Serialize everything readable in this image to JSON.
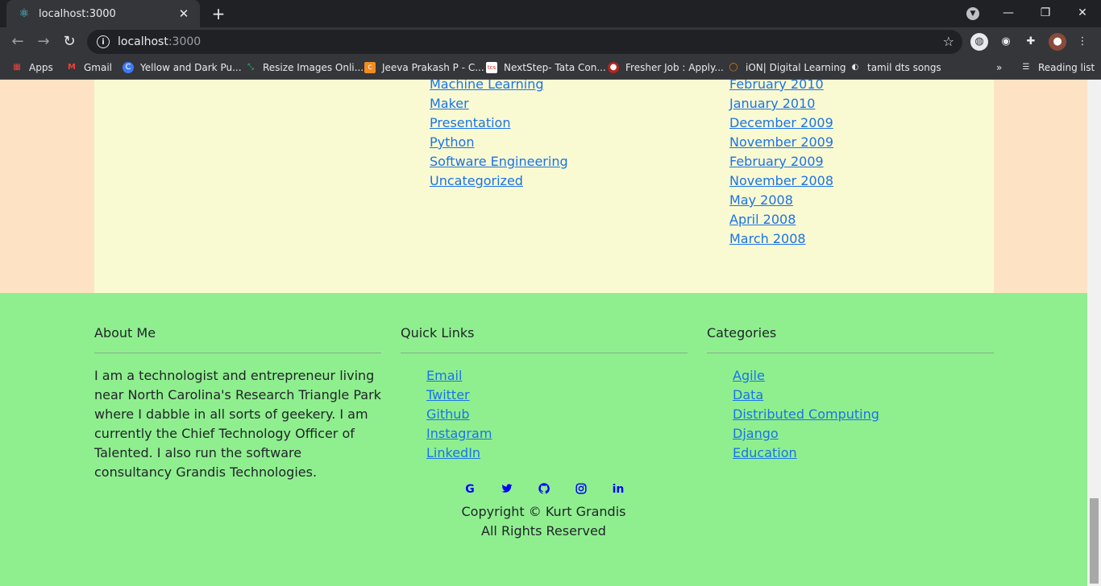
{
  "browser": {
    "tab_title": "localhost:3000",
    "url_host": "localhost",
    "url_port": ":3000",
    "bookmarks": [
      {
        "label": "Apps",
        "icon": "apps-icon",
        "color": "#e8453c"
      },
      {
        "label": "Gmail",
        "icon": "gmail-icon",
        "color": "#ea4335"
      },
      {
        "label": "Yellow and Dark Pu...",
        "icon": "canva-icon",
        "color": "#3d7af5"
      },
      {
        "label": "Resize Images Onli...",
        "icon": "resize-icon",
        "color": "#2bbf6a"
      },
      {
        "label": "Jeeva Prakash P - C...",
        "icon": "resume-icon",
        "color": "#f28b20"
      },
      {
        "label": "NextStep- Tata Con...",
        "icon": "tcs-icon",
        "color": "#d93025"
      },
      {
        "label": "Fresher Job : Apply...",
        "icon": "fresher-icon",
        "color": "#b3261e"
      },
      {
        "label": "iON| Digital Learning",
        "icon": "ion-icon",
        "color": "#f57c00"
      },
      {
        "label": "tamil dts songs",
        "icon": "globe-icon",
        "color": "#e8eaed"
      }
    ],
    "reading_list": "Reading list",
    "more_bookmarks": "»"
  },
  "blog": {
    "categories": [
      "Machine Learning",
      "Maker",
      "Presentation",
      "Python",
      "Software Engineering",
      "Uncategorized"
    ],
    "archives": [
      "February 2010",
      "January 2010",
      "December 2009",
      "November 2009",
      "February 2009",
      "November 2008",
      "May 2008",
      "April 2008",
      "March 2008"
    ]
  },
  "footer": {
    "about_title": "About Me",
    "about_text": "I am a technologist and entrepreneur living near North Carolina's Research Triangle Park where I dabble in all sorts of geekery. I am currently the Chief Technology Officer of Talented. I also run the software consultancy Grandis Technologies.",
    "quick_title": "Quick Links",
    "quick_links": [
      "Email",
      "Twitter",
      "Github",
      "Instagram",
      "LinkedIn"
    ],
    "cat_title": "Categories",
    "categories": [
      "Agile",
      "Data",
      "Distributed Computing",
      "Django",
      "Education"
    ],
    "social_icons": [
      "google-icon",
      "twitter-icon",
      "github-icon",
      "instagram-icon",
      "linkedin-icon"
    ],
    "copyright": "Copyright © Kurt Grandis",
    "rights": "All Rights Reserved"
  },
  "colors": {
    "footer_bg": "#8fef8f",
    "page_bg": "#fde3c4",
    "content_bg": "#fafad2",
    "link": "#1a73e8",
    "social": "#0000ff"
  }
}
